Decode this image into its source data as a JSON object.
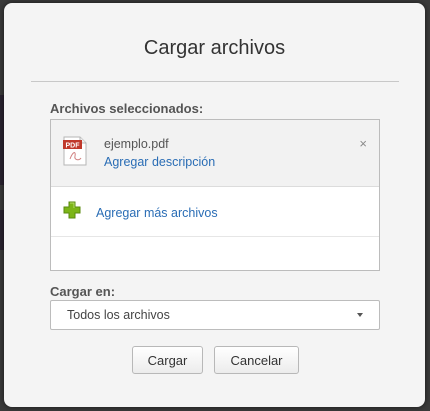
{
  "dialog": {
    "title": "Cargar archivos",
    "selected_files_label": "Archivos seleccionados:",
    "files": [
      {
        "name": "ejemplo.pdf",
        "icon": "pdf-file-icon",
        "icon_text": "PDF",
        "add_description_label": "Agregar descripción",
        "remove_glyph": "×"
      }
    ],
    "add_more_label": "Agregar más archivos",
    "upload_to_label": "Cargar en:",
    "upload_to_value": "Todos los archivos",
    "upload_button_label": "Cargar",
    "cancel_button_label": "Cancelar"
  },
  "colors": {
    "link": "#2a6db5",
    "dialog_bg": "#f4f4f4",
    "backdrop": "#3a3a3a",
    "pdf_red": "#c0392b",
    "plus_green": "#7cb518"
  }
}
